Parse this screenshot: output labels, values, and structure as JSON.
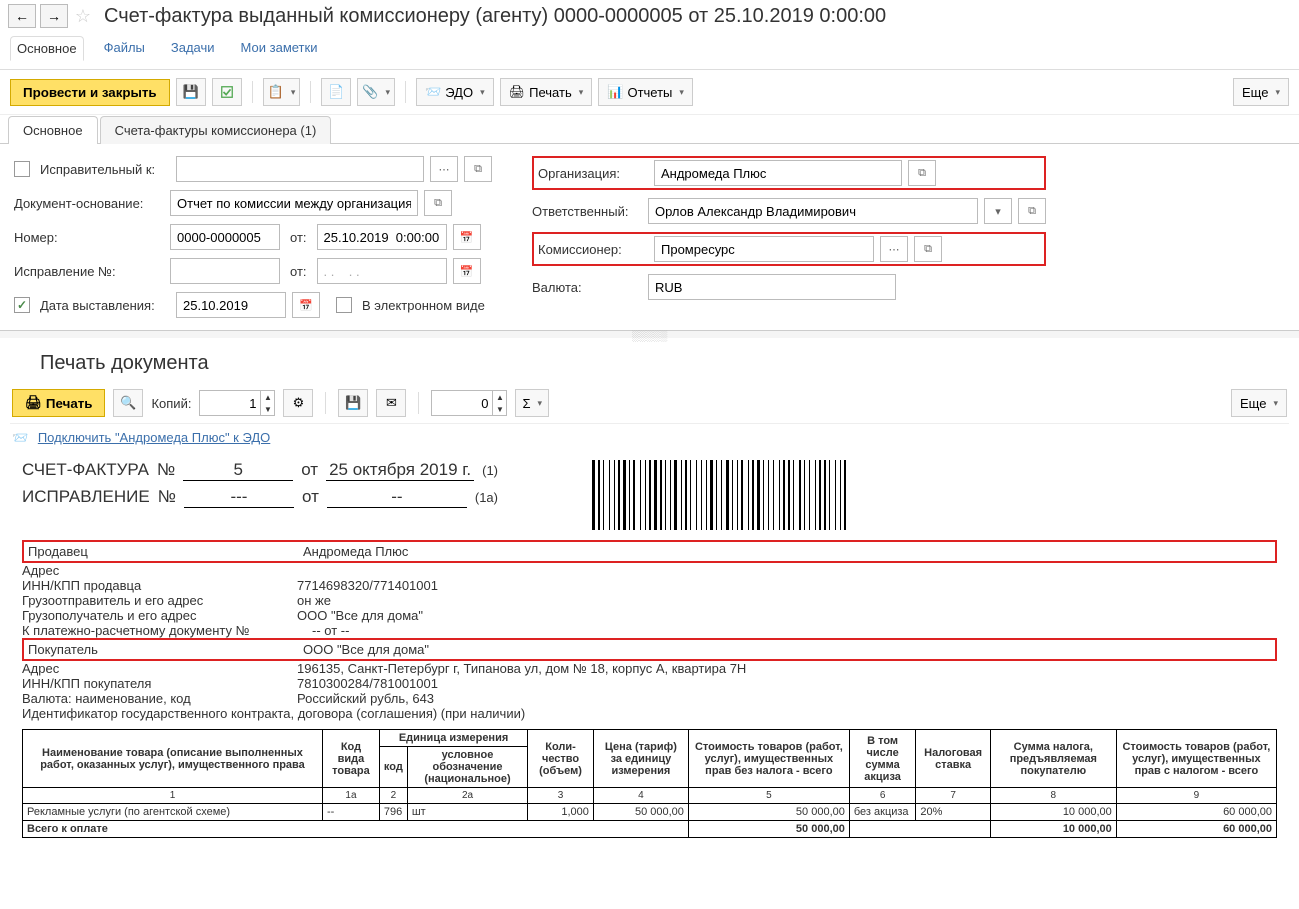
{
  "title": "Счет-фактура выданный комиссионеру (агенту) 0000-0000005 от 25.10.2019 0:00:00",
  "navtabs": {
    "main": "Основное",
    "files": "Файлы",
    "tasks": "Задачи",
    "notes": "Мои заметки"
  },
  "toolbar": {
    "post_close": "Провести и закрыть",
    "edo": "ЭДО",
    "print": "Печать",
    "reports": "Отчеты",
    "more": "Еще"
  },
  "form_tabs": {
    "main": "Основное",
    "comm": "Счета-фактуры комиссионера (1)"
  },
  "form": {
    "corr_label": "Исправительный к:",
    "basis_label": "Документ-основание:",
    "basis_value": "Отчет по комиссии между организациям",
    "num_label": "Номер:",
    "num_value": "0000-0000005",
    "from_label": "от:",
    "date_value": "25.10.2019  0:00:00",
    "corrnum_label": "Исправление №:",
    "corr_from_placeholder": ". .    . .",
    "issue_label": "Дата выставления:",
    "issue_value": "25.10.2019",
    "electronic": "В электронном виде",
    "org_label": "Организация:",
    "org_value": "Андромеда Плюс",
    "resp_label": "Ответственный:",
    "resp_value": "Орлов Александр Владимирович",
    "comm_label": "Комиссионер:",
    "comm_value": "Промресурс",
    "curr_label": "Валюта:",
    "curr_value": "RUB"
  },
  "print": {
    "title": "Печать документа",
    "print_btn": "Печать",
    "copies_label": "Копий:",
    "copies": "1",
    "zero": "0",
    "more": "Еще",
    "edo_link": "Подключить \"Андромеда Плюс\" к ЭДО"
  },
  "invoice": {
    "hdr1": "СЧЕТ-ФАКТУРА",
    "no_lbl": "№",
    "no_val": "5",
    "from_lbl": "от",
    "from_val": "25 октября 2019 г.",
    "paren1": "(1)",
    "hdr2": "ИСПРАВЛЕНИЕ",
    "no2": "---",
    "from2": "--",
    "paren2": "(1а)",
    "rows": {
      "seller_l": "Продавец",
      "seller_v": "Андромеда Плюс",
      "addr_l": "Адрес",
      "addr_v": "",
      "inn_l": "ИНН/КПП продавца",
      "inn_v": "7714698320/771401001",
      "cons_l": "Грузоотправитель и его адрес",
      "cons_v": "он же",
      "consign_l": "Грузополучатель и его адрес",
      "consign_v": "ООО \"Все для дома\"",
      "pay_l": "К платежно-расчетному документу №",
      "pay_v": "-- от --",
      "buyer_l": "Покупатель",
      "buyer_v": "ООО \"Все для дома\"",
      "addr2_l": "Адрес",
      "addr2_v": "196135, Санкт-Петербург г, Типанова ул, дом № 18, корпус А, квартира 7Н",
      "innb_l": "ИНН/КПП покупателя",
      "innb_v": "7810300284/781001001",
      "cur_l": "Валюта: наименование, код",
      "cur_v": "Российский рубль, 643",
      "ident": "Идентификатор государственного контракта, договора (соглашения) (при наличии)"
    },
    "th": {
      "name": "Наименование товара (описание выполненных работ, оказанных услуг), имущественного права",
      "code": "Код вида товара",
      "unit": "Единица измерения",
      "ucode": "код",
      "uname": "условное обозначение (национальное)",
      "qty": "Коли-чество (объем)",
      "price": "Цена (тариф) за единицу измерения",
      "cost": "Стоимость товаров (работ, услуг), имущественных прав без налога - всего",
      "excise": "В том числе сумма акциза",
      "rate": "Налоговая ставка",
      "taxsum": "Сумма налога, предъявляемая покупателю",
      "total": "Стоимость товаров (работ, услуг), имущественных прав с налогом - всего"
    },
    "nums": {
      "c1": "1",
      "c1a": "1а",
      "c2": "2",
      "c2a": "2а",
      "c3": "3",
      "c4": "4",
      "c5": "5",
      "c6": "6",
      "c7": "7",
      "c8": "8",
      "c9": "9"
    },
    "row1": {
      "name": "Рекламные услуги (по агентской схеме)",
      "code": "--",
      "ucode": "796",
      "uname": "шт",
      "qty": "1,000",
      "price": "50 000,00",
      "cost": "50 000,00",
      "excise": "без акциза",
      "rate": "20%",
      "tax": "10 000,00",
      "total": "60 000,00"
    },
    "totals": {
      "label": "Всего к оплате",
      "cost": "50 000,00",
      "tax": "10 000,00",
      "total": "60 000,00"
    }
  }
}
